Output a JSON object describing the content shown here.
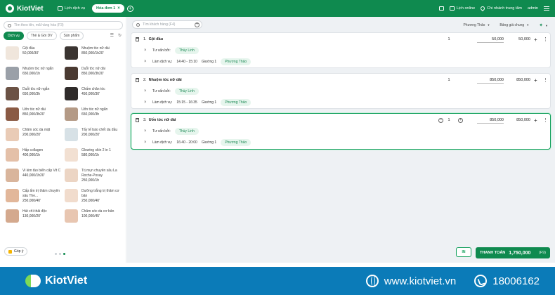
{
  "header": {
    "brand": "KiotViet",
    "tabs": [
      {
        "label": "Lịch dịch vụ",
        "active": false
      },
      {
        "label": "Hóa đơn 1",
        "active": true
      }
    ],
    "right": {
      "print_icon": "printer-icon",
      "schedule_online": "Lịch online",
      "branch": "Chi nhánh trung tâm",
      "user": "admin"
    }
  },
  "left": {
    "search_placeholder": "Tìm theo tên, mã hàng hóa (F3)",
    "subtabs": [
      "Dịch vụ",
      "Thẻ & Gói DV",
      "Sản phẩm"
    ],
    "services": [
      {
        "name": "Gội đầu",
        "price": "50,000/30'",
        "thumb": "#f0e6dc"
      },
      {
        "name": "Nhuộm tóc nữ dài",
        "price": "850,000/1h20'",
        "thumb": "#3a3431"
      },
      {
        "name": "Nhuộm tóc nữ ngắn",
        "price": "650,000/1h",
        "thumb": "#9aa0a8"
      },
      {
        "name": "Duỗi tóc nữ dài",
        "price": "850,000/3h20'",
        "thumb": "#4a3a32"
      },
      {
        "name": "Duỗi tóc nữ ngắn",
        "price": "650,000/3h",
        "thumb": "#6b5245"
      },
      {
        "name": "Chấm chân tóc",
        "price": "450,000/30'",
        "thumb": "#2f2b2a"
      },
      {
        "name": "Uốn tóc nữ dài",
        "price": "850,000/3h20'",
        "thumb": "#8a5a44"
      },
      {
        "name": "Uốn tóc nữ ngắn",
        "price": "650,000/3h",
        "thumb": "#b49a86"
      },
      {
        "name": "Chăm sóc da mặt",
        "price": "200,000/20'",
        "thumb": "#e9cbb6"
      },
      {
        "name": "Tẩy tế bào chết da đầu",
        "price": "200,000/20'",
        "thumb": "#d7e1e6"
      },
      {
        "name": "Hấp collagen",
        "price": "400,000/1h",
        "thumb": "#e4c0a8"
      },
      {
        "name": "Glowing skin 2 in 1",
        "price": "580,000/1h",
        "thumb": "#f2e0d2"
      },
      {
        "name": "Vi kim tảo biển cấp Vit C",
        "price": "440,000/1h20'",
        "thumb": "#d9b59c"
      },
      {
        "name": "Trị mụn chuyên sâu La Roche-Posay",
        "price": "250,000/1h",
        "thumb": "#ecd5c4"
      },
      {
        "name": "Cấp ẩm trị thâm chuyên sâu The...",
        "price": "250,000/40'",
        "thumb": "#e2b79a"
      },
      {
        "name": "Dưỡng trắng trị thâm cơ bản",
        "price": "250,000/40'",
        "thumb": "#f1dccd"
      },
      {
        "name": "Hút chì thải độc",
        "price": "130,000/20'",
        "thumb": "#d4a98e"
      },
      {
        "name": "Chăm sóc da cơ bản",
        "price": "100,000/45'",
        "thumb": "#e8c6b1"
      }
    ],
    "feedback": "Góp ý"
  },
  "right": {
    "customer_placeholder": "Tìm khách hàng (F4)",
    "staff_select": "Phương Thảo",
    "price_list": "Bảng giá chung",
    "lines": [
      {
        "no": "1.",
        "name": "Gội đầu",
        "qty": "1",
        "price": "50,000",
        "total": "50,000",
        "consultant_label": "Tư vấn bởi:",
        "consultant": "Thùy Linh",
        "service_label": "Làm dịch vụ:",
        "time": "14:40 - 15:10",
        "bed": "Giường 1",
        "staff": "Phương Thảo"
      },
      {
        "no": "2.",
        "name": "Nhuộm tóc nữ dài",
        "qty": "1",
        "price": "850,000",
        "total": "850,000",
        "consultant_label": "Tư vấn bởi:",
        "consultant": "Thùy Linh",
        "service_label": "Làm dịch vụ:",
        "time": "15:15 - 16:35",
        "bed": "Giường 1",
        "staff": "Phương Thảo"
      },
      {
        "no": "3.",
        "name": "Uốn tóc nữ dài",
        "qty": "1",
        "price": "850,000",
        "total": "850,000",
        "consultant_label": "Tư vấn bởi:",
        "consultant": "Thùy Linh",
        "service_label": "Làm dịch vụ:",
        "time": "16:40 - 20:00",
        "bed": "Giường 1",
        "staff": "Phương Thảo"
      }
    ],
    "print_button": "IN",
    "pay_label": "THANH TOÁN",
    "pay_amount": "1,750,000",
    "pay_key": "(F9)"
  },
  "footer": {
    "brand": "KiotViet",
    "website": "www.kiotviet.vn",
    "hotline": "18006162"
  }
}
